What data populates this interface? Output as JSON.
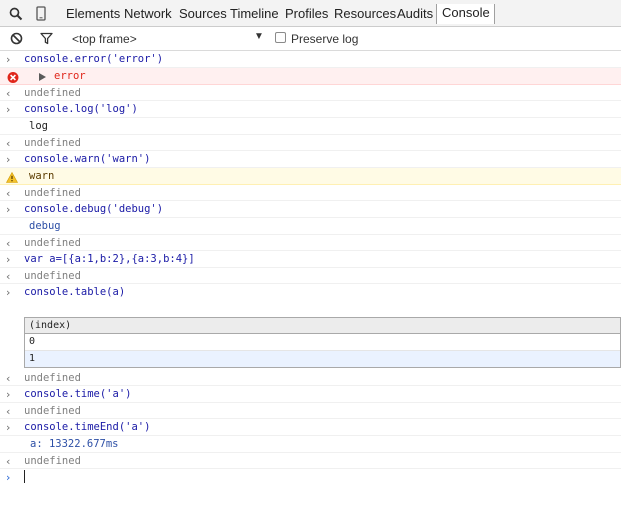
{
  "tabs": [
    "Elements",
    "Network",
    "Sources",
    "Timeline",
    "Profiles",
    "Resources",
    "Audits",
    "Console"
  ],
  "icons": {
    "search": "search-icon",
    "device": "device-mode-icon",
    "clear": "clear-console-icon",
    "filter": "filter-icon",
    "dropdown": "dropdown-arrow-icon",
    "error": "error-icon",
    "warning": "warning-icon",
    "expand": "expand-triangle-icon",
    "input": "input-chevron-icon",
    "result": "result-chevron-icon",
    "prompt": "prompt-icon"
  },
  "colors": {
    "input_text": "#1a1aa6",
    "error_text": "#e0261b",
    "warning_bg": "#fffbe5",
    "error_bg": "#fff0f0"
  },
  "toolbar": {
    "frame": "<top frame>",
    "preserve_log": "Preserve log",
    "preserve_log_checked": false
  },
  "console": {
    "lines": [
      "console.error('error')",
      "error",
      "undefined",
      "console.log('log')",
      "log",
      "undefined",
      "console.warn('warn')",
      "warn",
      "undefined",
      "console.debug('debug')",
      "debug",
      "undefined",
      "var a=[{a:1,b:2},{a:3,b:4}]",
      "undefined",
      "console.table(a)",
      "undefined",
      "console.time('a')",
      "undefined",
      "console.timeEnd('a')",
      "a: 13322.677ms",
      "undefined"
    ],
    "table": {
      "header": "(index)",
      "rows": [
        "0",
        "1"
      ]
    },
    "prompt_value": ""
  }
}
